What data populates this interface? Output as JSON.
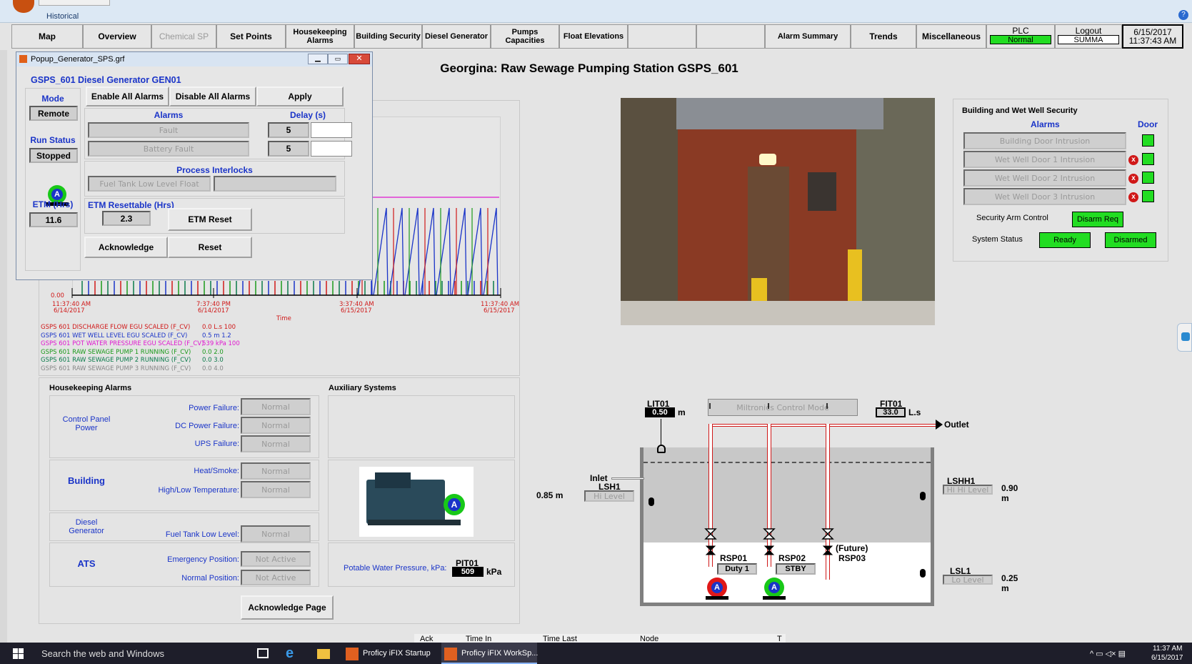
{
  "window": {
    "title": "Historical"
  },
  "nav": {
    "items": [
      "Map",
      "Overview",
      "Chemical SP",
      "Set Points",
      "Housekeeping Alarms",
      "Building Security",
      "Diesel Generator",
      "Pumps Capacities",
      "Float Elevations",
      "",
      "",
      "Alarm Summary",
      "Trends",
      "Miscellaneous"
    ],
    "plc_label": "PLC",
    "plc_status": "Normal",
    "logout": "Logout",
    "user": "SUMMA",
    "date": "6/15/2017",
    "time": "11:37:43 AM"
  },
  "page_title": "Georgina: Raw Sewage Pumping Station GSPS_601",
  "popup": {
    "window_title": "Popup_Generator_SPS.grf",
    "heading": "GSPS_601 Diesel Generator GEN01",
    "mode_label": "Mode",
    "mode_value": "Remote",
    "run_status_label": "Run Status",
    "run_status_value": "Stopped",
    "etm_label": "ETM (Hrs)",
    "etm_value": "11.6",
    "enable_all": "Enable All Alarms",
    "disable_all": "Disable All Alarms",
    "apply": "Apply",
    "alarms_label": "Alarms",
    "delay_label": "Delay (s)",
    "alarms": [
      {
        "name": "Fault",
        "delay": "5"
      },
      {
        "name": "Battery Fault",
        "delay": "5"
      }
    ],
    "interlocks_label": "Process Interlocks",
    "interlock": "Fuel Tank Low Level Float",
    "etm_resettable_label": "ETM Resettable (Hrs)",
    "etm_resettable_value": "2.3",
    "etm_reset": "ETM Reset",
    "acknowledge": "Acknowledge",
    "reset": "Reset",
    "pump_badge": "A"
  },
  "trend": {
    "y_zero": "0.00",
    "x_ticks": [
      {
        "time": "11:37:40 AM",
        "date": "6/14/2017"
      },
      {
        "time": "7:37:40 PM",
        "date": "6/14/2017"
      },
      {
        "time": "3:37:40 AM",
        "date": "6/15/2017"
      },
      {
        "time": "11:37:40 AM",
        "date": "6/15/2017"
      }
    ],
    "xlabel": "Time",
    "legend": [
      {
        "name": "GSPS 601 DISCHARGE FLOW EGU SCALED (F_CV)",
        "value": "0.0",
        "unit": "L.s",
        "max": "100",
        "color": "#d01818"
      },
      {
        "name": "GSPS 601 WET WELL LEVEL EGU SCALED (F_CV)",
        "value": "0.5",
        "unit": "m",
        "max": "1.2",
        "color": "#1a34c8"
      },
      {
        "name": "GSPS 601 POT WATER PRESSURE EGU SCALED (F_CV)",
        "value": "539",
        "unit": "kPa",
        "max": "100",
        "color": "#e018d0"
      },
      {
        "name": "GSPS 601 RAW SEWAGE PUMP 1 RUNNING (F_CV)",
        "value": "0.0",
        "unit": "",
        "max": "2.0",
        "color": "#1a9a1a"
      },
      {
        "name": "GSPS 601 RAW SEWAGE PUMP 2 RUNNING (F_CV)",
        "value": "0.0",
        "unit": "",
        "max": "3.0",
        "color": "#0a7a4a"
      },
      {
        "name": "GSPS 601 RAW SEWAGE PUMP 3 RUNNING (F_CV)",
        "value": "0.0",
        "unit": "",
        "max": "4.0",
        "color": "#888888"
      }
    ]
  },
  "housekeeping": {
    "title": "Housekeeping Alarms",
    "aux_title": "Auxiliary Systems",
    "groups": [
      "Control Panel Power",
      "Building",
      "Diesel Generator",
      "ATS"
    ],
    "rows": [
      {
        "label": "Power Failure:",
        "value": "Normal"
      },
      {
        "label": "DC Power Failure:",
        "value": "Normal"
      },
      {
        "label": "UPS Failure:",
        "value": "Normal"
      },
      {
        "label": "Heat/Smoke:",
        "value": "Normal"
      },
      {
        "label": "High/Low Temperature:",
        "value": "Normal"
      },
      {
        "label": "Fuel Tank Low Level:",
        "value": "Normal"
      },
      {
        "label": "Emergency Position:",
        "value": "Not Active"
      },
      {
        "label": "Normal Position:",
        "value": "Not Active"
      }
    ],
    "pressure_label": "Potable Water Pressure, kPa:",
    "pit_tag": "PIT01",
    "pit_value": "509",
    "pit_unit": "kPa",
    "ack_page": "Acknowledge Page",
    "gen_badge": "A"
  },
  "security": {
    "title": "Building and Wet Well Security",
    "alarms_label": "Alarms",
    "door_label": "Door",
    "alarms": [
      "Building Door Intrusion",
      "Wet Well Door 1 Intrusion",
      "Wet Well Door 2 Intrusion",
      "Wet Well Door 3 Intrusion"
    ],
    "arm_label": "Security Arm Control",
    "arm_value": "Disarm Req",
    "status_label": "System Status",
    "status_ready": "Ready",
    "status_disarmed": "Disarmed",
    "x_mark": "x"
  },
  "diagram": {
    "lit_tag": "LIT01",
    "lit_value": "0.50",
    "lit_unit": "m",
    "mode_box": "Miltronics Control Mode",
    "fit_tag": "FIT01",
    "fit_value": "33.0",
    "fit_unit": "L.s",
    "outlet": "Outlet",
    "inlet": "Inlet",
    "lsh_tag": "LSH1",
    "lsh_text": "Hi Level",
    "lsh_level": "0.85 m",
    "lshh_tag": "LSHH1",
    "lshh_text": "Hi Hi Level",
    "lshh_level": "0.90 m",
    "lsl_tag": "LSL1",
    "lsl_text": "Lo Level",
    "lsl_level": "0.25 m",
    "pumps": [
      {
        "tag": "RSP01",
        "state": "Duty 1",
        "badge": "A",
        "color": "#e01818"
      },
      {
        "tag": "RSP02",
        "state": "STBY",
        "badge": "A",
        "color": "#18c818"
      },
      {
        "tag": "RSP03",
        "state": "(Future)",
        "badge": "",
        "color": ""
      }
    ]
  },
  "alarm_header": [
    "Ack",
    "Time In",
    "Time Last",
    "Node",
    "T"
  ],
  "taskbar": {
    "search": "Search the web and Windows",
    "apps": [
      "Proficy iFIX Startup",
      "Proficy iFIX WorkSp..."
    ],
    "time": "11:37 AM",
    "date": "6/15/2017"
  }
}
